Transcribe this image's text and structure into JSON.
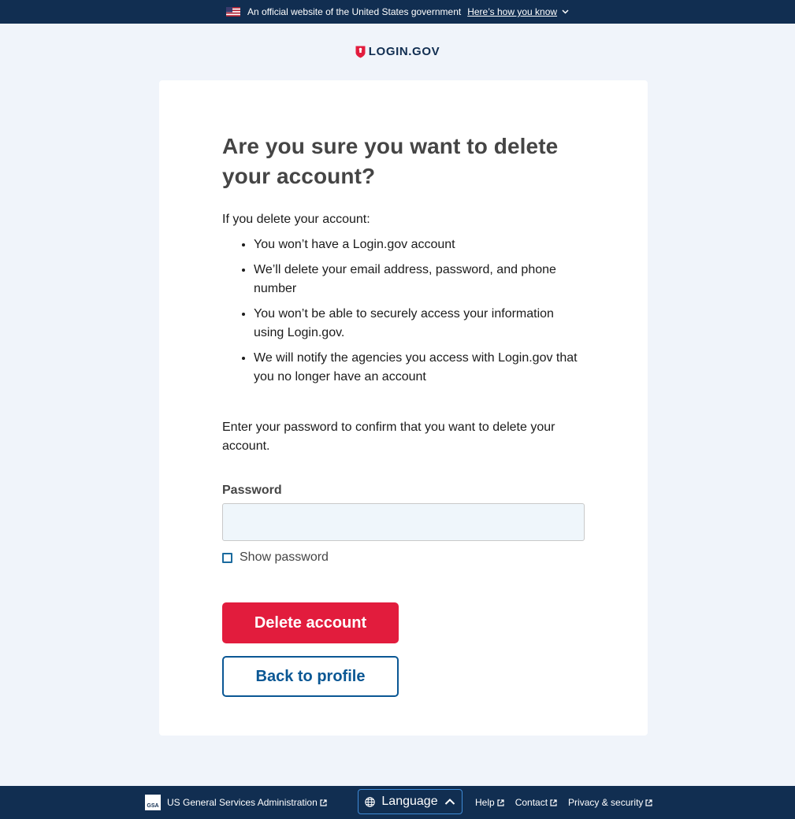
{
  "banner": {
    "official_text": "An official website of the United States government",
    "how_you_know": "Here’s how you know"
  },
  "logo": {
    "text": "LOGIN.GOV"
  },
  "main": {
    "heading": "Are you sure you want to delete your account?",
    "intro": "If you delete your account:",
    "bullets": [
      "You won’t have a Login.gov account",
      "We’ll delete your email address, password, and phone number",
      "You won’t be able to securely access your information using Login.gov.",
      "We will notify the agencies you access with Login.gov that you no longer have an account"
    ],
    "confirm_text": "Enter your password to confirm that you want to delete your account.",
    "password_label": "Password",
    "password_value": "",
    "show_password_label": "Show password",
    "show_password_checked": false,
    "delete_button": "Delete account",
    "back_button": "Back to profile"
  },
  "footer": {
    "gsa_label": "US General Services Administration",
    "gsa_logo_text": "GSA",
    "language_label": "Language",
    "links": [
      "Help",
      "Contact",
      "Privacy & security"
    ]
  },
  "colors": {
    "banner_bg": "#112e51",
    "delete_red": "#e21c3d",
    "link_blue": "#0a5794",
    "page_bg": "#f0f4fa"
  }
}
